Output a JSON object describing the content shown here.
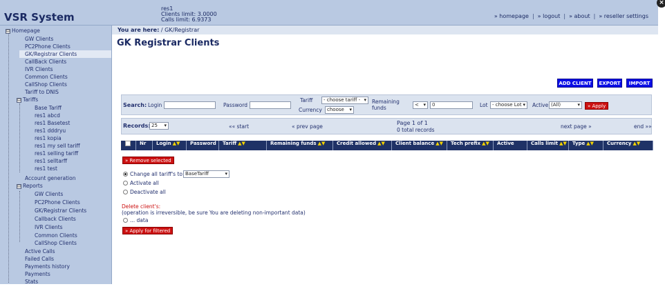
{
  "header": {
    "app_title": "VSR System",
    "user_lines": [
      "res1",
      "Clients limit: 3.0000",
      "Calls limit: 6.9373"
    ],
    "nav": [
      "» homepage",
      "» logout",
      "» about",
      "» reseller settings"
    ],
    "close_glyph": "×"
  },
  "sidebar": {
    "root": {
      "label": "Homepage",
      "box": "⊟"
    },
    "items_top": [
      "GW Clients",
      "PC2Phone Clients",
      "GK/Registrar Clients",
      "CallBack Clients",
      "IVR Clients",
      "Common Clients",
      "CallShop Clients",
      "Tariff to DNIS"
    ],
    "tariffs": {
      "label": "Tariffs",
      "box": "⊟",
      "children": [
        "Base Tariff",
        "res1 abcd",
        "res1 Basetest",
        "res1 dddryu",
        "res1 kopia",
        "res1 my sell tariff",
        "res1 selling tariff",
        "res1 selltarff",
        "res1 test"
      ]
    },
    "account_generation": "Account generation",
    "reports": {
      "label": "Reports",
      "box": "⊟",
      "children": [
        "GW Clients",
        "PC2Phone Clients",
        "GK/Registrar Clients",
        "Callback Clients",
        "IVR Clients",
        "Common Clients",
        "CallShop Clients"
      ]
    },
    "items_bottom": [
      "Active Calls",
      "Failed Calls",
      "Payments history",
      "Payments",
      "Stats"
    ]
  },
  "main": {
    "breadcrumb_prefix": "You are here:",
    "breadcrumb_path": "/ GK/Registrar",
    "title": "GK Registrar Clients",
    "buttons": {
      "add": "ADD CLIENT",
      "export": "EXPORT",
      "import": "IMPORT"
    },
    "search": {
      "label": "Search:",
      "login_label": "Login",
      "login_value": "",
      "password_label": "Password",
      "password_value": "",
      "tariff_label": "Tariff",
      "tariff_value": "- choose tariff -",
      "currency_label": "Currency",
      "currency_value": "choose",
      "remaining_label_1": "Remaining",
      "remaining_label_2": "funds",
      "remaining_op": "<",
      "remaining_value": "0",
      "lot_label": "Lot",
      "lot_value": "- choose Lot -",
      "active_label": "Active",
      "active_value": "(All)",
      "apply_label": "» Apply"
    },
    "records": {
      "label": "Records:",
      "per_page": "25",
      "start": "«« start",
      "prev": "« prev page",
      "page_info": "Page 1 of 1",
      "total": "0 total records",
      "next": "next page »",
      "end": "end »»"
    },
    "table_columns": [
      {
        "label": "Nr",
        "sort": false
      },
      {
        "label": "Login",
        "sort": true
      },
      {
        "label": "Password",
        "sort": false
      },
      {
        "label": "Tariff",
        "sort": true
      },
      {
        "label": "Remaining funds",
        "sort": true
      },
      {
        "label": "Credit allowed",
        "sort": true
      },
      {
        "label": "Client balance",
        "sort": true
      },
      {
        "label": "Tech prefix",
        "sort": true
      },
      {
        "label": "Active",
        "sort": false
      },
      {
        "label": "Calls limit",
        "sort": true
      },
      {
        "label": "Type",
        "sort": true
      },
      {
        "label": "Currency",
        "sort": true
      }
    ],
    "sort_glyph": "▲▼",
    "remove_selected": "» Remove selected",
    "options": {
      "change_tariff_label": "Change all tariff's to:",
      "change_tariff_value": "BaseTariff",
      "activate_all": "Activate all",
      "deactivate_all": "Deactivate all",
      "delete_heading": "Delete client's:",
      "delete_warning": "(operation is irreversible, be sure You are deleting non-important data)",
      "data_option": "... data",
      "apply_filtered": "» Apply for filtered"
    }
  },
  "colors": {
    "header_bg": "#b9c9e2",
    "table_header_bg": "#1f3266",
    "blue_button": "#0b0ee6",
    "red_button": "#cc1111"
  }
}
